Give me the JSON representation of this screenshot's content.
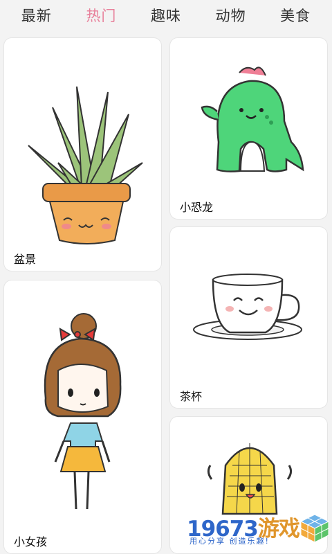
{
  "tabs": [
    {
      "label": "最新"
    },
    {
      "label": "热门"
    },
    {
      "label": "趣味"
    },
    {
      "label": "动物"
    },
    {
      "label": "美食"
    }
  ],
  "active_tab": "热门",
  "cards": {
    "plant": {
      "label": "盆景"
    },
    "dino": {
      "label": "小恐龙"
    },
    "girl": {
      "label": "小女孩"
    },
    "cup": {
      "label": "茶杯"
    },
    "corn": {
      "label": ""
    }
  },
  "watermark": {
    "number": "19673",
    "brand": "游戏",
    "tagline": "用心分享 创造乐趣!"
  },
  "colors": {
    "active_tab": "#e8819b",
    "watermark_blue": "#2e66c9",
    "watermark_orange": "#e0962c"
  }
}
